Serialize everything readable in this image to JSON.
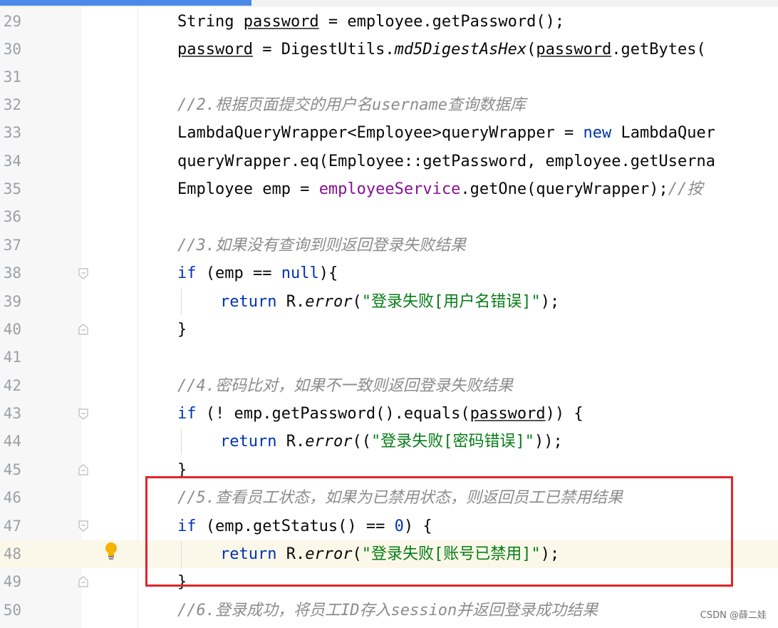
{
  "lines": [
    {
      "n": "29",
      "id": "line-29"
    },
    {
      "n": "30",
      "id": "line-30"
    },
    {
      "n": "31",
      "id": "line-31"
    },
    {
      "n": "32",
      "id": "line-32"
    },
    {
      "n": "33",
      "id": "line-33"
    },
    {
      "n": "34",
      "id": "line-34"
    },
    {
      "n": "35",
      "id": "line-35"
    },
    {
      "n": "36",
      "id": "line-36"
    },
    {
      "n": "37",
      "id": "line-37"
    },
    {
      "n": "38",
      "id": "line-38"
    },
    {
      "n": "39",
      "id": "line-39"
    },
    {
      "n": "40",
      "id": "line-40"
    },
    {
      "n": "41",
      "id": "line-41"
    },
    {
      "n": "42",
      "id": "line-42"
    },
    {
      "n": "43",
      "id": "line-43"
    },
    {
      "n": "44",
      "id": "line-44"
    },
    {
      "n": "45",
      "id": "line-45"
    },
    {
      "n": "46",
      "id": "line-46"
    },
    {
      "n": "47",
      "id": "line-47"
    },
    {
      "n": "48",
      "id": "line-48"
    },
    {
      "n": "49",
      "id": "line-49"
    },
    {
      "n": "50",
      "id": "line-50"
    }
  ],
  "code": {
    "l29": {
      "a": "String ",
      "b": "password",
      "c": " = employee.getPassword();"
    },
    "l30": {
      "a": "password",
      "b": " = DigestUtils.",
      "c": "md5DigestAsHex",
      "d": "(",
      "e": "password",
      "f": ".getBytes("
    },
    "l32": {
      "comment": "//2.根据页面提交的用户名username查询数据库"
    },
    "l33": {
      "a": "LambdaQueryWrapper<Employee>queryWrapper = ",
      "kw": "new",
      "b": " LambdaQuer"
    },
    "l34": {
      "a": "queryWrapper.eq(Employee::getPassword, employee.getUserna"
    },
    "l35": {
      "a": "Employee emp = ",
      "fld": "employeeService",
      "b": ".getOne(queryWrapper);",
      "cmt": "//按"
    },
    "l37": {
      "comment": "//3.如果没有查询到则返回登录失败结果"
    },
    "l38": {
      "kw": "if",
      "a": " (emp == ",
      "kw2": "null",
      "b": "){"
    },
    "l39": {
      "kw": "return",
      "a": " R.",
      "itl": "error",
      "b": "(",
      "str": "\"登录失败[用户名错误]\"",
      "c": ");"
    },
    "l40": {
      "a": "}"
    },
    "l42": {
      "comment": "//4.密码比对，如果不一致则返回登录失败结果"
    },
    "l43": {
      "kw": "if",
      "a": " (! emp.getPassword().equals(",
      "ul": "password",
      "b": ")) {"
    },
    "l44": {
      "kw": "return",
      "a": " R.",
      "itl": "error",
      "b": "((",
      "str": "\"登录失败[密码错误]\"",
      "c": "));"
    },
    "l45": {
      "a": "}"
    },
    "l46": {
      "comment": "//5.查看员工状态，如果为已禁用状态，则返回员工已禁用结果"
    },
    "l47": {
      "kw": "if",
      "a": " (emp.getStatus() == ",
      "num": "0",
      "b": ") {"
    },
    "l48": {
      "kw": "return",
      "a": " R.",
      "itl": "error",
      "b": "(",
      "str": "\"登录失败[账号已禁用]\"",
      "c": ");"
    },
    "l49": {
      "a": "}"
    },
    "l50": {
      "comment": "//6.登录成功，将员工ID存入session并返回登录成功结果"
    }
  },
  "watermark": "CSDN @薛二娃",
  "colors": {
    "keyword": "#0033b3",
    "string": "#067d17",
    "field": "#871094",
    "comment": "#8c8c8c",
    "highlight_box": "#e0252c",
    "current_line": "#fbf8e9"
  },
  "icons": {
    "intention": "lightbulb-icon",
    "fold": "fold-marker-icon"
  }
}
